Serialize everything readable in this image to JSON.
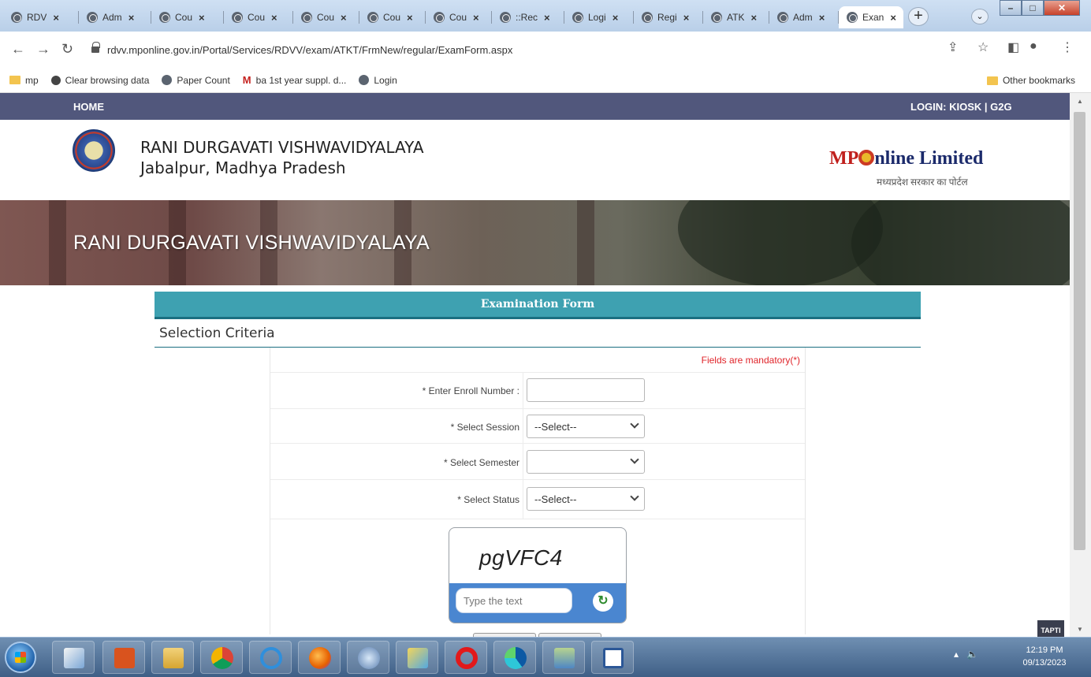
{
  "browser": {
    "tabs": [
      {
        "label": "RDV",
        "close": "×"
      },
      {
        "label": "Adm",
        "close": "×"
      },
      {
        "label": "Cou",
        "close": "×"
      },
      {
        "label": "Cou",
        "close": "×"
      },
      {
        "label": "Cou",
        "close": "×"
      },
      {
        "label": "Cou",
        "close": "×"
      },
      {
        "label": "Cou",
        "close": "×"
      },
      {
        "label": "::Rec",
        "close": "×"
      },
      {
        "label": "Logi",
        "close": "×"
      },
      {
        "label": "Regi",
        "close": "×"
      },
      {
        "label": "ATK",
        "close": "×"
      },
      {
        "label": "Adm",
        "close": "×"
      },
      {
        "label": "Exan",
        "close": "×"
      }
    ],
    "new_tab": "+",
    "url": "rdvv.mponline.gov.in/Portal/Services/RDVV/exam/ATKT/FrmNew/regular/ExamForm.aspx",
    "bookmarks": [
      {
        "label": "mp",
        "icon": "folder-icon"
      },
      {
        "label": "Clear browsing data",
        "icon": "gear-icon"
      },
      {
        "label": "Paper Count",
        "icon": "globe-icon"
      },
      {
        "label": "ba 1st year suppl. d...",
        "icon": "gmail-icon"
      },
      {
        "label": "Login",
        "icon": "globe-icon"
      }
    ],
    "other_bookmarks": "Other bookmarks"
  },
  "page": {
    "nav": {
      "home": "HOME",
      "login": "LOGIN: KIOSK | G2G"
    },
    "header": {
      "university": "RANI DURGAVATI VISHWAVIDYALAYA",
      "location": "Jabalpur, Madhya Pradesh",
      "mponline_mp": "MP",
      "mponline_rest": "nline Limited",
      "mponline_hindi": "मध्यप्रदेश सरकार का पोर्टल"
    },
    "banner_title": "RANI DURGAVATI VISHWAVIDYALAYA",
    "form_title": "Examination Form",
    "section_title": "Selection Criteria",
    "mandatory_note": "Fields are mandatory(*)",
    "fields": {
      "enroll_label": "* Enter Enroll Number :",
      "enroll_value": "",
      "session_label": "* Select Session",
      "session_value": "--Select--",
      "semester_label": "* Select Semester",
      "semester_value": "",
      "status_label": "* Select Status",
      "status_value": "--Select--"
    },
    "captcha": {
      "code": "pgVFC4",
      "placeholder": "Type the text",
      "refresh_glyph": "↻"
    },
    "corner_badge": "TAPTI"
  },
  "taskbar": {
    "time": "12:19 PM",
    "date": "09/13/2023"
  }
}
